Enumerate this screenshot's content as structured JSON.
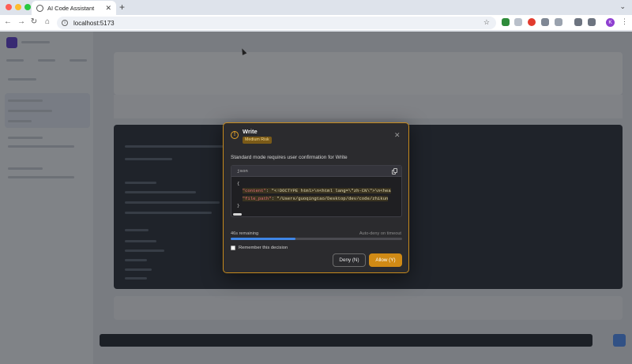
{
  "browser": {
    "tab_title": "AI Code Assistant",
    "url": "localhost:5173",
    "profile_initial": "K"
  },
  "modal": {
    "title": "Write",
    "risk_badge": "Medium Risk",
    "description": "Standard mode requires user confirmation for Write",
    "code_language": "json",
    "code_lines": {
      "open": "{",
      "content_key": "\"content\"",
      "content_value": "\"<!DOCTYPE html>\\n<html lang=\\\"zh-CN\\\">\\n<hea",
      "file_path_key": "\"file_path\"",
      "file_path_value": "\"/Users/guoqingtao/Desktop/dev/code/zhikun",
      "close": "}"
    },
    "timer_label": "46s remaining",
    "auto_deny_label": "Auto-deny on timeout",
    "timer_fraction": 0.38,
    "remember_label": "Remember this decision",
    "remember_checked": false,
    "deny_label": "Deny (N)",
    "allow_label": "Allow (Y)"
  },
  "colors": {
    "accent_warning": "#e4a229",
    "allow_button": "#d08a15",
    "progress": "#3f86e6"
  }
}
